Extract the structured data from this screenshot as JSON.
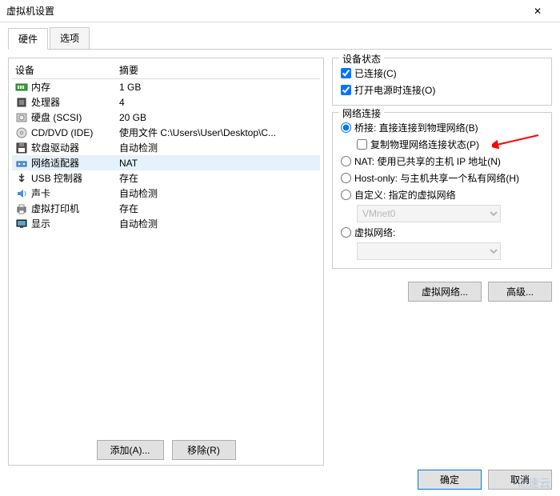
{
  "window": {
    "title": "虚拟机设置"
  },
  "tabs": {
    "hardware": "硬件",
    "options": "选项"
  },
  "table": {
    "header_device": "设备",
    "header_summary": "摘要",
    "rows": [
      {
        "name": "内存",
        "summary": "1 GB",
        "icon": "memory"
      },
      {
        "name": "处理器",
        "summary": "4",
        "icon": "cpu"
      },
      {
        "name": "硬盘 (SCSI)",
        "summary": "20 GB",
        "icon": "disk"
      },
      {
        "name": "CD/DVD (IDE)",
        "summary": "使用文件 C:\\Users\\User\\Desktop\\C...",
        "icon": "cd"
      },
      {
        "name": "软盘驱动器",
        "summary": "自动检测",
        "icon": "floppy"
      },
      {
        "name": "网络适配器",
        "summary": "NAT",
        "icon": "network"
      },
      {
        "name": "USB 控制器",
        "summary": "存在",
        "icon": "usb"
      },
      {
        "name": "声卡",
        "summary": "自动检测",
        "icon": "sound"
      },
      {
        "name": "虚拟打印机",
        "summary": "存在",
        "icon": "printer"
      },
      {
        "name": "显示",
        "summary": "自动检测",
        "icon": "display"
      }
    ]
  },
  "left_buttons": {
    "add": "添加(A)...",
    "remove": "移除(R)"
  },
  "device_status": {
    "title": "设备状态",
    "connected": "已连接(C)",
    "connect_at_power": "打开电源时连接(O)"
  },
  "network": {
    "title": "网络连接",
    "bridged": "桥接: 直接连接到物理网络(B)",
    "replicate": "复制物理网络连接状态(P)",
    "nat": "NAT: 使用已共享的主机 IP 地址(N)",
    "hostonly": "Host-only: 与主机共享一个私有网络(H)",
    "custom": "自定义: 指定的虚拟网络",
    "vmnet_option": "VMnet0",
    "virtual": "虚拟网络:"
  },
  "right_buttons": {
    "vnet": "虚拟网络...",
    "advanced": "高级..."
  },
  "bottom": {
    "ok": "确定",
    "cancel": "取消"
  },
  "watermark": "亿速云"
}
